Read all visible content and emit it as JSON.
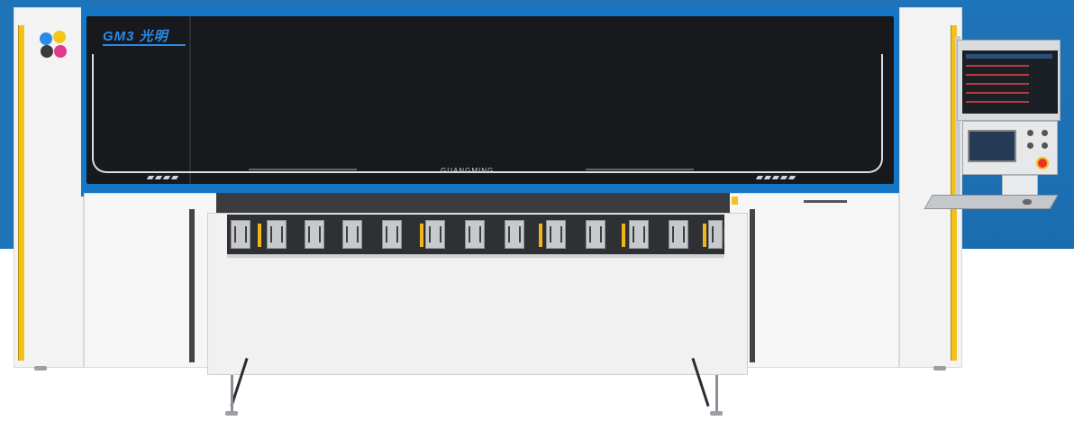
{
  "machine": {
    "brand_logo": "GM3 光明",
    "head_text": "GUANGMING",
    "ink_dot_colors": [
      "#2a8be6",
      "#f5c518",
      "#e03a8c",
      "#222222"
    ]
  },
  "colors": {
    "background_blue": "#1f73b7",
    "head_blue": "#1677c7",
    "head_black": "#17191c",
    "safety_yellow": "#f1c21b",
    "estop_red": "#e8332a"
  }
}
